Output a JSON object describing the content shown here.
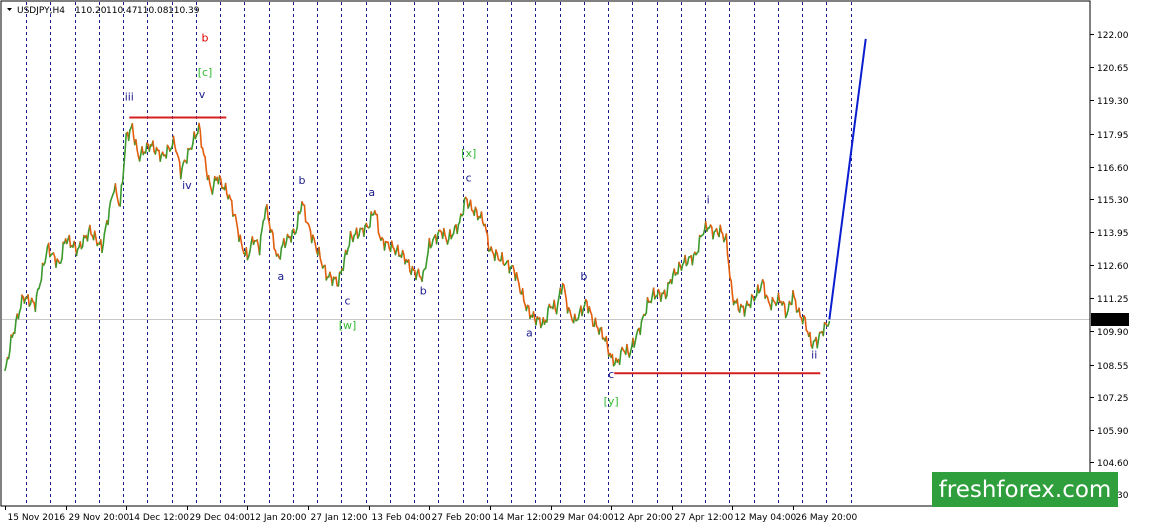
{
  "chart_data": {
    "type": "line",
    "symbol": "USDJPY,H4",
    "ohlc": [
      "110.20",
      "110.47",
      "110.08",
      "110.39"
    ],
    "current_price": 110.39,
    "ylim": [
      102.8,
      123.3
    ],
    "y_ticks": [
      122.0,
      120.65,
      119.3,
      117.95,
      116.6,
      115.3,
      113.95,
      112.6,
      111.25,
      109.9,
      108.55,
      107.25,
      105.9,
      104.6,
      103.3
    ],
    "x_labels": [
      "15 Nov 2016",
      "29 Nov 20:00",
      "14 Dec 12:00",
      "29 Dec 04:00",
      "12 Jan 20:00",
      "27 Jan 12:00",
      "13 Feb 04:00",
      "27 Feb 20:00",
      "14 Mar 12:00",
      "29 Mar 04:00",
      "12 Apr 20:00",
      "27 Apr 12:00",
      "12 May 04:00",
      "26 May 20:00"
    ],
    "x_label_index": [
      0,
      10,
      20,
      30,
      40,
      50,
      60,
      70,
      80,
      90,
      100,
      110,
      120,
      130
    ],
    "x_index_range": [
      -0.5,
      179
    ],
    "period_separators": [
      3.5,
      7.5,
      11.5,
      15.5,
      19.5,
      23.5,
      27.5,
      31.5,
      35.5,
      39.5,
      43.5,
      47.5,
      51.5,
      55.5,
      59.5,
      63.5,
      67.5,
      71.5,
      75.5,
      79.5,
      83.5,
      87.5,
      91.5,
      95.5,
      99.5,
      103.5,
      107.5,
      111.5,
      115.5,
      119.5,
      123.5,
      127.5,
      131.5,
      135.5,
      139.5
    ],
    "price_path": [
      [
        0,
        108.2
      ],
      [
        1,
        109.5
      ],
      [
        3,
        111.3
      ],
      [
        5,
        111.0
      ],
      [
        7,
        113.3
      ],
      [
        9,
        112.6
      ],
      [
        10,
        113.7
      ],
      [
        12,
        113.2
      ],
      [
        14,
        114.0
      ],
      [
        16,
        113.3
      ],
      [
        18,
        115.8
      ],
      [
        19,
        115.0
      ],
      [
        20,
        117.8
      ],
      [
        21,
        118.2
      ],
      [
        22,
        117.0
      ],
      [
        24,
        117.5
      ],
      [
        26,
        117.0
      ],
      [
        28,
        117.6
      ],
      [
        29,
        116.4
      ],
      [
        31,
        117.6
      ],
      [
        32,
        118.2
      ],
      [
        33,
        116.8
      ],
      [
        34,
        115.6
      ],
      [
        35,
        116.2
      ],
      [
        37,
        115.4
      ],
      [
        38,
        114.5
      ],
      [
        39,
        113.4
      ],
      [
        40,
        112.9
      ],
      [
        41,
        113.7
      ],
      [
        42,
        113.3
      ],
      [
        43,
        115.0
      ],
      [
        45,
        112.8
      ],
      [
        46,
        113.5
      ],
      [
        48,
        114.0
      ],
      [
        49,
        115.2
      ],
      [
        50,
        114.2
      ],
      [
        52,
        112.9
      ],
      [
        53,
        112.2
      ],
      [
        55,
        111.9
      ],
      [
        56,
        112.8
      ],
      [
        57,
        113.7
      ],
      [
        60,
        114.2
      ],
      [
        61,
        114.9
      ],
      [
        62,
        113.6
      ],
      [
        64,
        113.3
      ],
      [
        66,
        112.9
      ],
      [
        67,
        112.4
      ],
      [
        69,
        112.1
      ],
      [
        70,
        113.4
      ],
      [
        72,
        114.0
      ],
      [
        73,
        113.6
      ],
      [
        75,
        114.3
      ],
      [
        76,
        115.3
      ],
      [
        77,
        114.9
      ],
      [
        79,
        114.4
      ],
      [
        80,
        113.2
      ],
      [
        82,
        112.8
      ],
      [
        84,
        112.4
      ],
      [
        86,
        110.9
      ],
      [
        87,
        110.5
      ],
      [
        89,
        110.2
      ],
      [
        90,
        111.0
      ],
      [
        91,
        110.8
      ],
      [
        92,
        111.9
      ],
      [
        93,
        110.7
      ],
      [
        94,
        110.3
      ],
      [
        96,
        111.1
      ],
      [
        97,
        110.3
      ],
      [
        98,
        110.0
      ],
      [
        99,
        109.6
      ],
      [
        100,
        108.8
      ],
      [
        101,
        108.6
      ],
      [
        102,
        109.2
      ],
      [
        103,
        109.0
      ],
      [
        104,
        109.6
      ],
      [
        105,
        110.2
      ],
      [
        106,
        111.0
      ],
      [
        107,
        111.4
      ],
      [
        109,
        111.4
      ],
      [
        110,
        112.1
      ],
      [
        111,
        112.4
      ],
      [
        112,
        112.7
      ],
      [
        114,
        113.0
      ],
      [
        115,
        113.9
      ],
      [
        116,
        114.2
      ],
      [
        117,
        113.9
      ],
      [
        118,
        114.0
      ],
      [
        119,
        113.6
      ],
      [
        120,
        111.3
      ],
      [
        121,
        110.9
      ],
      [
        122,
        110.8
      ],
      [
        124,
        111.4
      ],
      [
        125,
        111.9
      ],
      [
        126,
        111.0
      ],
      [
        127,
        111.1
      ],
      [
        128,
        111.2
      ],
      [
        129,
        110.6
      ],
      [
        130,
        111.4
      ],
      [
        131,
        110.6
      ],
      [
        132,
        110.3
      ],
      [
        133,
        109.4
      ],
      [
        134,
        109.5
      ],
      [
        135,
        110.0
      ],
      [
        136,
        110.3
      ]
    ],
    "forecast_line": [
      [
        136,
        110.39
      ],
      [
        142,
        121.8
      ]
    ],
    "horizontal_levels": [
      {
        "x1": 20.5,
        "x2": 36.5,
        "y": 118.6,
        "color": "#d42020"
      },
      {
        "x1": 100.5,
        "x2": 134.5,
        "y": 108.2,
        "color": "#d42020"
      }
    ],
    "wave_labels": [
      {
        "text": "b",
        "x": 33,
        "y": 121.7,
        "color": "#e00000"
      },
      {
        "text": "[c]",
        "x": 33,
        "y": 120.3,
        "color": "#33bb33"
      },
      {
        "text": "iii",
        "x": 20.5,
        "y": 119.3,
        "color": "#1a1a8c"
      },
      {
        "text": "v",
        "x": 32.5,
        "y": 119.4,
        "color": "#1a1a8c"
      },
      {
        "text": "iv",
        "x": 30,
        "y": 115.7,
        "color": "#1a1a8c"
      },
      {
        "text": "b",
        "x": 49,
        "y": 115.9,
        "color": "#1a1a8c"
      },
      {
        "text": "a",
        "x": 45.5,
        "y": 112.0,
        "color": "#1a1a8c"
      },
      {
        "text": "c",
        "x": 56.5,
        "y": 111.0,
        "color": "#1a1a8c"
      },
      {
        "text": "[w]",
        "x": 56.5,
        "y": 110.0,
        "color": "#33bb33"
      },
      {
        "text": "a",
        "x": 60.5,
        "y": 115.4,
        "color": "#1a1a8c"
      },
      {
        "text": "b",
        "x": 69,
        "y": 111.4,
        "color": "#1a1a8c"
      },
      {
        "text": "[x]",
        "x": 76.5,
        "y": 117.0,
        "color": "#33bb33"
      },
      {
        "text": "c",
        "x": 76.5,
        "y": 116.0,
        "color": "#1a1a8c"
      },
      {
        "text": "a",
        "x": 86.5,
        "y": 109.7,
        "color": "#1a1a8c"
      },
      {
        "text": "b",
        "x": 95.5,
        "y": 112.0,
        "color": "#1a1a8c"
      },
      {
        "text": "c",
        "x": 100,
        "y": 108.0,
        "color": "#1a1a8c"
      },
      {
        "text": "[y]",
        "x": 100,
        "y": 106.9,
        "color": "#33bb33"
      },
      {
        "text": "i",
        "x": 116,
        "y": 115.1,
        "color": "#1a1a8c"
      },
      {
        "text": "ii",
        "x": 133.5,
        "y": 108.8,
        "color": "#1a1a8c"
      }
    ],
    "colors": {
      "bull": "#3c9a2d",
      "bear": "#e25d0c",
      "separator": "#1a1a8c",
      "forecast": "#0a1ecf",
      "current_line": "#c8c8c8",
      "price_tag": "#000000",
      "brand_bg": "#2f9f3d"
    },
    "grid": false
  },
  "watermark": {
    "text": "freshforex.com"
  }
}
